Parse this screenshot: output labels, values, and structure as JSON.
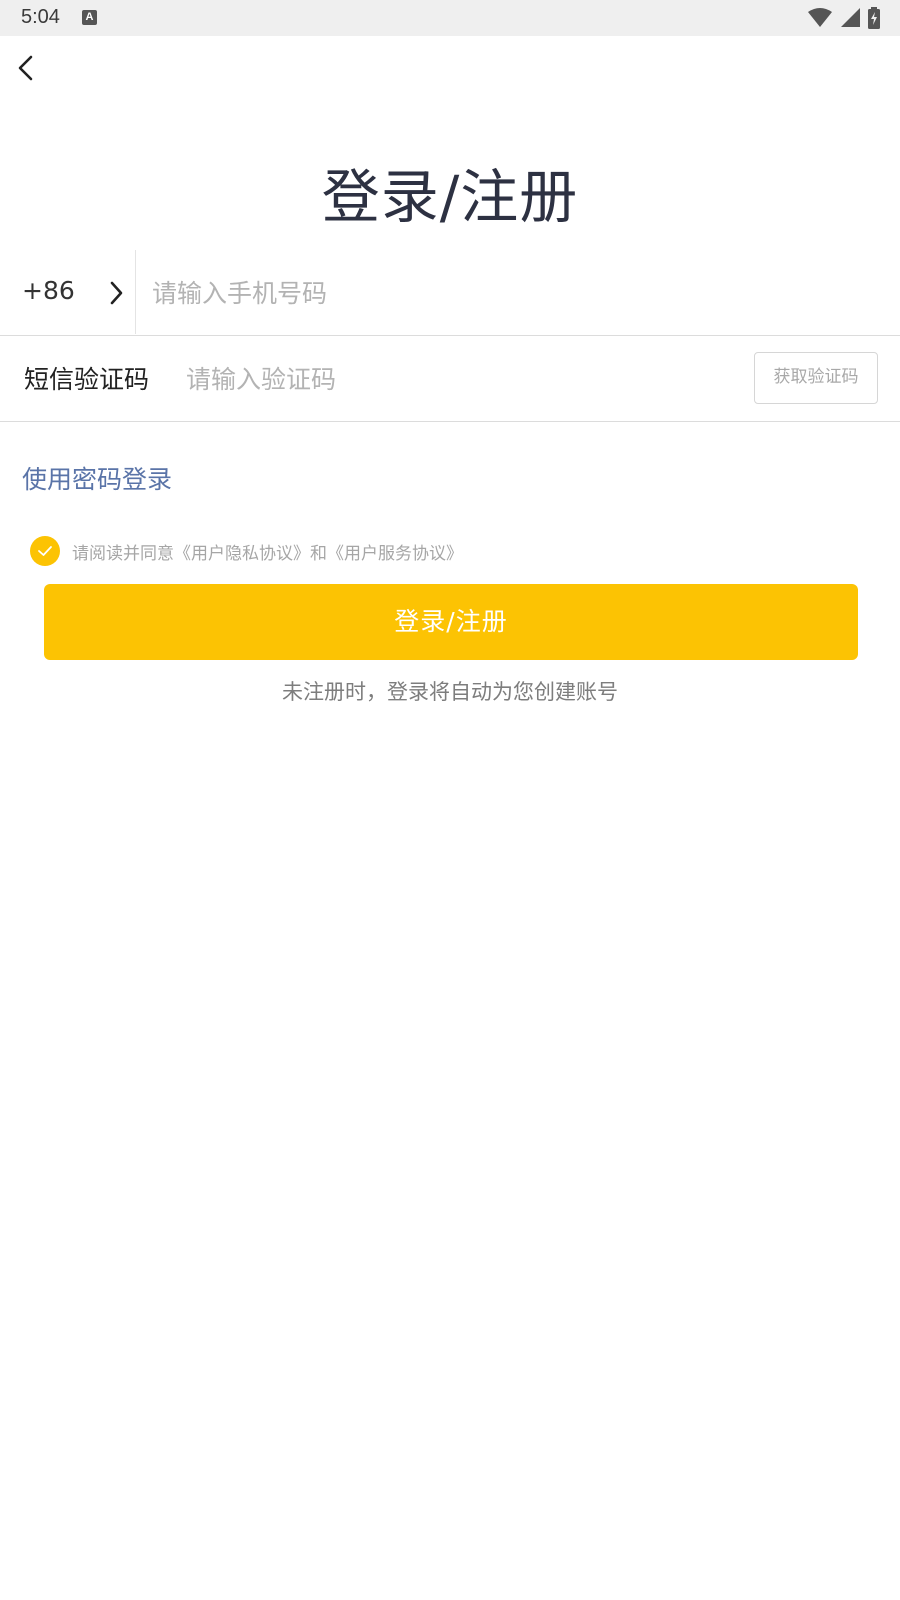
{
  "status_bar": {
    "time": "5:04",
    "notification_icon": "A",
    "icons": [
      "wifi-icon",
      "cellular-signal-icon",
      "battery-charging-icon"
    ]
  },
  "header": {
    "back_icon": "chevron-left-icon",
    "title": "登录/注册"
  },
  "phone": {
    "country_code": "+86",
    "chevron_icon": "chevron-right-icon",
    "placeholder": "请输入手机号码"
  },
  "sms": {
    "label": "短信验证码",
    "placeholder": "请输入验证码",
    "get_code_label": "获取验证码"
  },
  "password_login_label": "使用密码登录",
  "agreement": {
    "checked": true,
    "prefix": "请阅读并同意",
    "privacy_link": "《用户隐私协议》",
    "conjunction": "和",
    "service_link": "《用户服务协议》"
  },
  "login_button_label": "登录/注册",
  "auto_register_note": "未注册时，登录将自动为您创建账号",
  "colors": {
    "accent": "#fcc303",
    "link": "#5a74a8",
    "title": "#2d3142"
  }
}
